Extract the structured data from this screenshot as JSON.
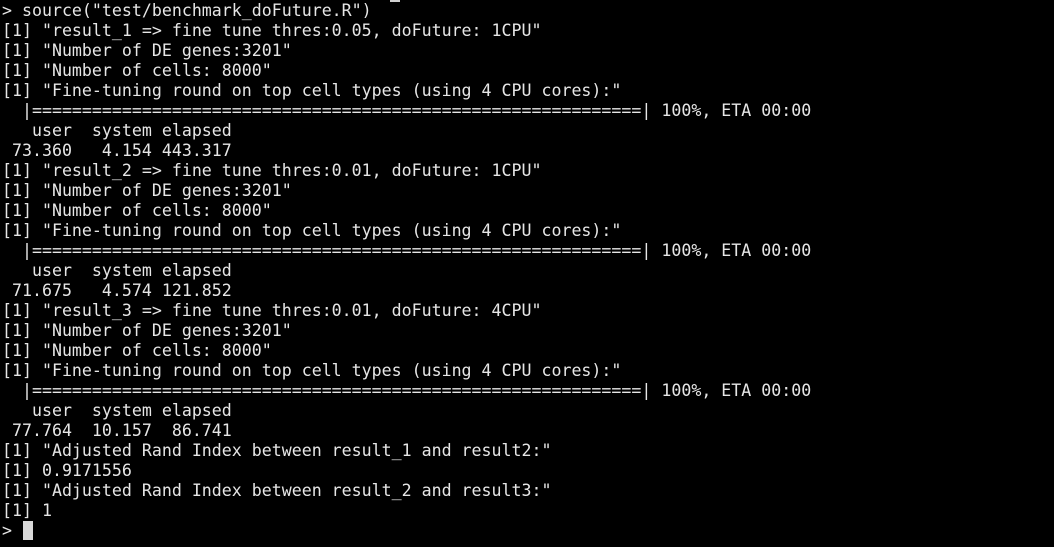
{
  "terminal": {
    "colors": {
      "background": "#000000",
      "text": "#e6e6e6",
      "cursor": "#d9d9d9"
    },
    "lines": [
      "> source(\"test/benchmark_doFuture.R\")",
      "[1] \"result_1 => fine tune thres:0.05, doFuture: 1CPU\"",
      "[1] \"Number of DE genes:3201\"",
      "[1] \"Number of cells: 8000\"",
      "[1] \"Fine-tuning round on top cell types (using 4 CPU cores):\"",
      "  |=============================================================| 100%, ETA 00:00",
      "   user  system elapsed",
      " 73.360   4.154 443.317",
      "[1] \"result_2 => fine tune thres:0.01, doFuture: 1CPU\"",
      "[1] \"Number of DE genes:3201\"",
      "[1] \"Number of cells: 8000\"",
      "[1] \"Fine-tuning round on top cell types (using 4 CPU cores):\"",
      "  |=============================================================| 100%, ETA 00:00",
      "   user  system elapsed",
      " 71.675   4.574 121.852",
      "[1] \"result_3 => fine tune thres:0.01, doFuture: 4CPU\"",
      "[1] \"Number of DE genes:3201\"",
      "[1] \"Number of cells: 8000\"",
      "[1] \"Fine-tuning round on top cell types (using 4 CPU cores):\"",
      "  |=============================================================| 100%, ETA 00:00",
      "   user  system elapsed",
      " 77.764  10.157  86.741",
      "[1] \"Adjusted Rand Index between result_1 and result2:\"",
      "[1] 0.9171556",
      "[1] \"Adjusted Rand Index between result_2 and result3:\"",
      "[1] 1"
    ],
    "prompt": "> "
  }
}
